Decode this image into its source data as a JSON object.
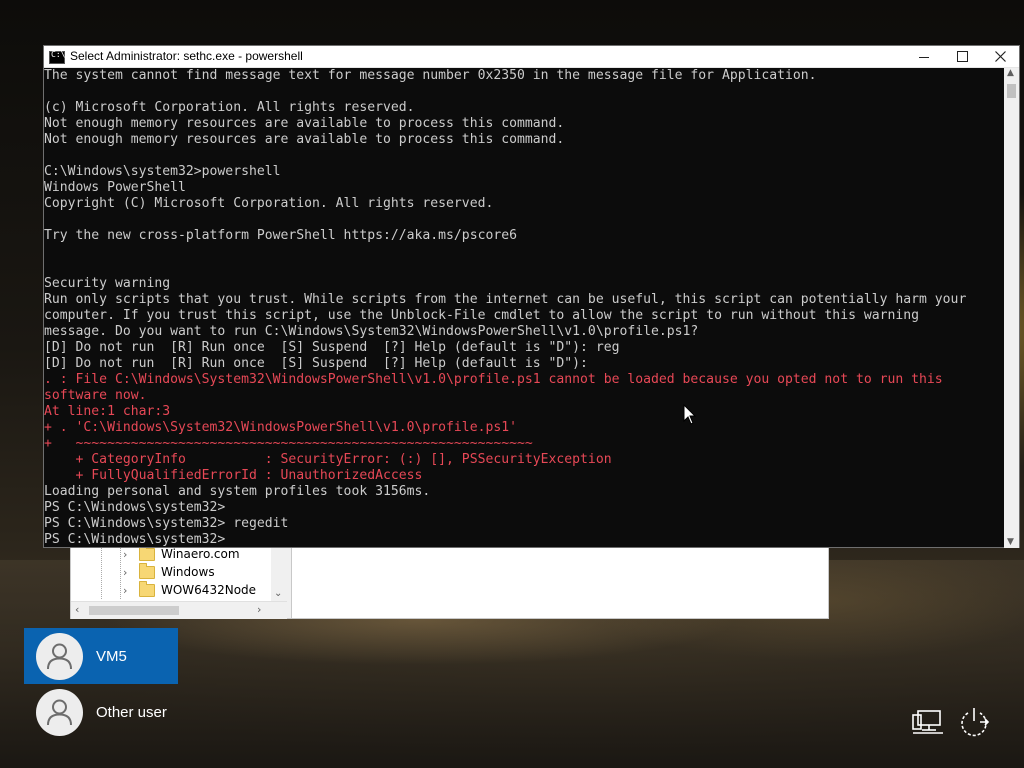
{
  "console": {
    "title": "Select Administrator: sethc.exe - powershell",
    "title_icon_glyph": "C:\\",
    "lines": [
      {
        "text": "The system cannot find message text for message number 0x2350 in the message file for Application.",
        "type": "out"
      },
      {
        "text": "",
        "type": "out"
      },
      {
        "text": "(c) Microsoft Corporation. All rights reserved.",
        "type": "out"
      },
      {
        "text": "Not enough memory resources are available to process this command.",
        "type": "out"
      },
      {
        "text": "Not enough memory resources are available to process this command.",
        "type": "out"
      },
      {
        "text": "",
        "type": "out"
      },
      {
        "text": "C:\\Windows\\system32>powershell",
        "type": "out"
      },
      {
        "text": "Windows PowerShell",
        "type": "out"
      },
      {
        "text": "Copyright (C) Microsoft Corporation. All rights reserved.",
        "type": "out"
      },
      {
        "text": "",
        "type": "out"
      },
      {
        "text": "Try the new cross-platform PowerShell https://aka.ms/pscore6",
        "type": "out"
      },
      {
        "text": "",
        "type": "out"
      },
      {
        "text": "",
        "type": "out"
      },
      {
        "text": "Security warning",
        "type": "out"
      },
      {
        "text": "Run only scripts that you trust. While scripts from the internet can be useful, this script can potentially harm your",
        "type": "out"
      },
      {
        "text": "computer. If you trust this script, use the Unblock-File cmdlet to allow the script to run without this warning",
        "type": "out"
      },
      {
        "text": "message. Do you want to run C:\\Windows\\System32\\WindowsPowerShell\\v1.0\\profile.ps1?",
        "type": "out"
      },
      {
        "text": "[D] Do not run  [R] Run once  [S] Suspend  [?] Help (default is \"D\"): reg",
        "type": "out"
      },
      {
        "text": "[D] Do not run  [R] Run once  [S] Suspend  [?] Help (default is \"D\"):",
        "type": "out"
      },
      {
        "text": ". : File C:\\Windows\\System32\\WindowsPowerShell\\v1.0\\profile.ps1 cannot be loaded because you opted not to run this",
        "type": "err"
      },
      {
        "text": "software now.",
        "type": "err"
      },
      {
        "text": "At line:1 char:3",
        "type": "err"
      },
      {
        "text": "+ . 'C:\\Windows\\System32\\WindowsPowerShell\\v1.0\\profile.ps1'",
        "type": "err"
      },
      {
        "text": "+   ~~~~~~~~~~~~~~~~~~~~~~~~~~~~~~~~~~~~~~~~~~~~~~~~~~~~~~~~~~",
        "type": "err"
      },
      {
        "text": "    + CategoryInfo          : SecurityError: (:) [], PSSecurityException",
        "type": "err"
      },
      {
        "text": "    + FullyQualifiedErrorId : UnauthorizedAccess",
        "type": "err"
      },
      {
        "text": "Loading personal and system profiles took 3156ms.",
        "type": "out"
      },
      {
        "text": "PS C:\\Windows\\system32>",
        "type": "out"
      },
      {
        "text": "PS C:\\Windows\\system32> regedit",
        "type": "out"
      },
      {
        "text": "PS C:\\Windows\\system32>",
        "type": "out"
      }
    ]
  },
  "regedit": {
    "tree_items": [
      "Winaero.com",
      "Windows",
      "WOW6432Node"
    ]
  },
  "login": {
    "users": [
      {
        "name": "VM5",
        "selected": true
      },
      {
        "name": "Other user",
        "selected": false
      }
    ]
  },
  "icons": {
    "network": "network-icon",
    "power": "power-icon",
    "user": "user-icon"
  },
  "colors": {
    "console_bg": "#0c0c0c",
    "console_text": "#cccccc",
    "error_text": "#e74856",
    "selected_user_bg": "#0a63b0",
    "folder": "#f7d774"
  }
}
